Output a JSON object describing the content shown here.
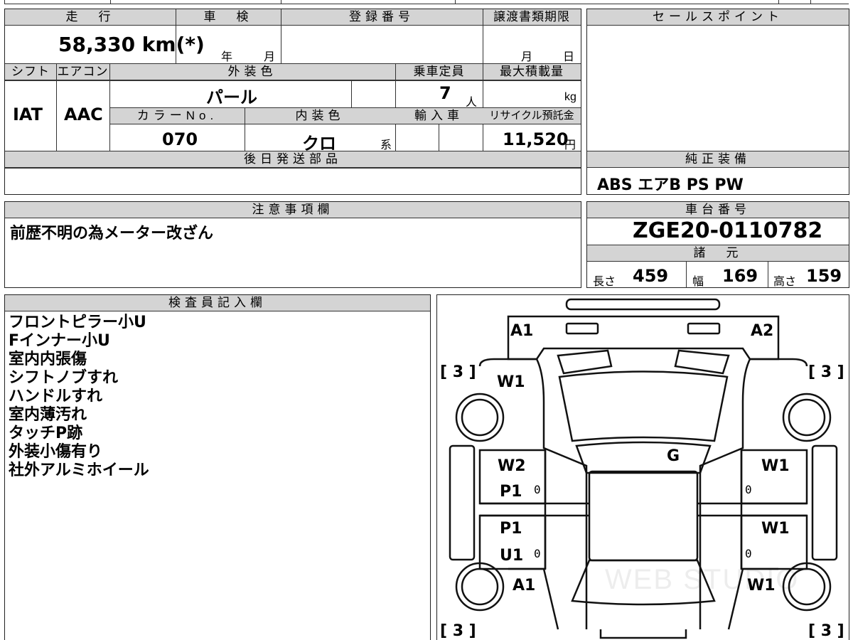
{
  "top": {
    "mileage_header": "走　行",
    "shaken_header": "車　検",
    "reg_header": "登録番号",
    "transfer_header": "譲渡書類期限",
    "sales_header": "セールスポイント",
    "mileage": "58,330 km(*)",
    "shaken_year": "年",
    "shaken_month": "月",
    "transfer_month": "月",
    "transfer_day": "日",
    "shift_header": "シフト",
    "ac_header": "エアコン",
    "exterior_header": "外装色",
    "capacity_header": "乗車定員",
    "maxload_header": "最大積載量",
    "shift": "IAT",
    "ac": "AAC",
    "exterior_color": "パール",
    "capacity": "7",
    "capacity_unit": "人",
    "maxload_unit": "kg",
    "color_no_header": "カラーNo.",
    "interior_header": "内装色",
    "import_header": "輸入車",
    "recycle_header": "リサイクル預託金",
    "color_no": "070",
    "interior_color": "クロ",
    "interior_unit": "系",
    "recycle_fee": "11,520",
    "recycle_unit": "円",
    "later_parts_header": "後日発送部品",
    "genuine_header": "純正装備",
    "genuine_equipment": "ABS エアB PS PW"
  },
  "caution": {
    "header": "注意事項欄",
    "text": "前歴不明の為メーター改ざん"
  },
  "chassis": {
    "header": "車台番号",
    "number": "ZGE20-0110782",
    "spec_header": "諸　元",
    "length_label": "長さ",
    "length": "459",
    "width_label": "幅",
    "width": "169",
    "height_label": "高さ",
    "height": "159"
  },
  "inspector": {
    "header": "検査員記入欄",
    "notes": [
      "フロントピラー小U",
      "Fインナー小U",
      "室内内張傷",
      "シフトノブすれ",
      "ハンドルすれ",
      "室内薄汚れ",
      "タッチP跡",
      "外装小傷有り",
      "社外アルミホイール"
    ]
  },
  "diagram": {
    "marks": {
      "a1_front": "A1",
      "a2_front": "A2",
      "w1_fl": "W1",
      "g_roof": "G",
      "w2_left_door": "W2",
      "p1_left_front": "P1",
      "p1_left_rear": "P1",
      "u1_left_rear": "U1",
      "w1_right_front_door": "W1",
      "w1_right_rear_door": "W1",
      "a1_rear_left": "A1",
      "w1_rear_right": "W1",
      "tire_fl": "[ 3 ]",
      "tire_fr": "[ 3 ]",
      "tire_rl": "[ 3 ]",
      "tire_rr": "[ 3 ]",
      "zero": "0"
    },
    "watermark": "WEB STUDIO"
  }
}
